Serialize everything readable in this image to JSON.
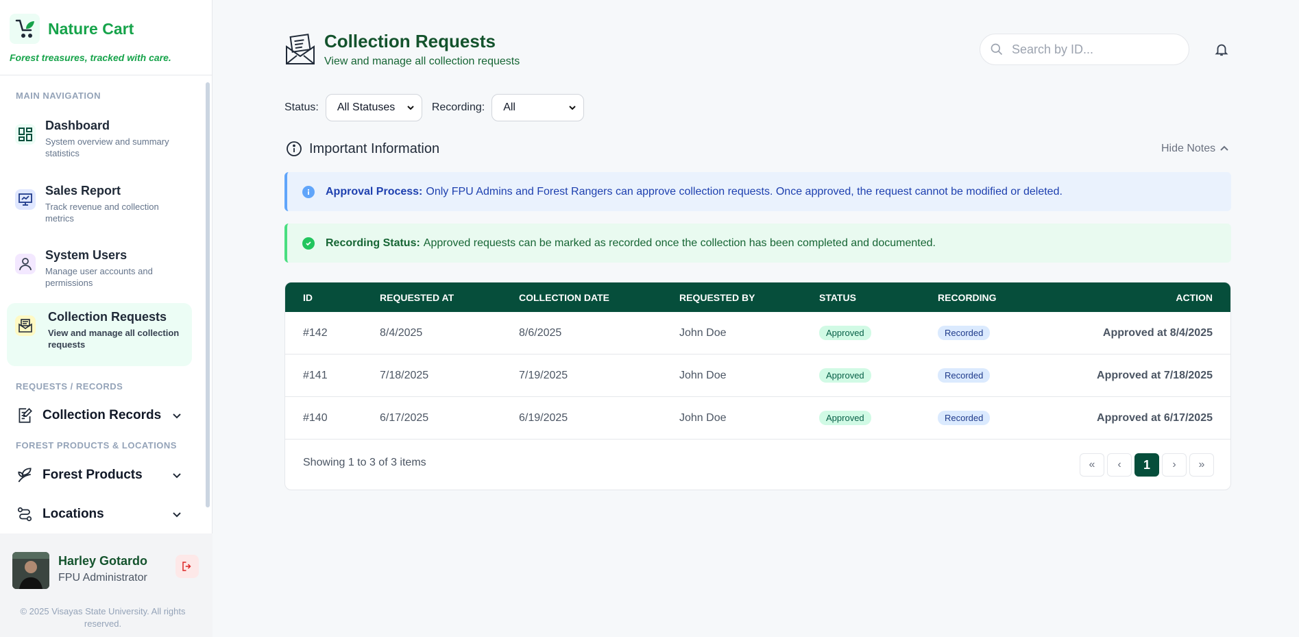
{
  "brand": {
    "name": "Nature Cart",
    "tagline": "Forest treasures, tracked with care."
  },
  "sidebar": {
    "main_nav_label": "MAIN NAVIGATION",
    "items": [
      {
        "title": "Dashboard",
        "desc": "System overview and summary statistics"
      },
      {
        "title": "Sales Report",
        "desc": "Track revenue and collection metrics"
      },
      {
        "title": "System Users",
        "desc": "Manage user accounts and permissions"
      },
      {
        "title": "Collection Requests",
        "desc": "View and manage all collection requests"
      }
    ],
    "requests_label": "REQUESTS / RECORDS",
    "collection_records": "Collection Records",
    "forest_label": "FOREST PRODUCTS & LOCATIONS",
    "forest_products": "Forest Products",
    "locations": "Locations"
  },
  "profile": {
    "name": "Harley Gotardo",
    "role": "FPU Administrator",
    "copyright": "© 2025 Visayas State University. All rights reserved."
  },
  "header": {
    "title": "Collection Requests",
    "subtitle": "View and manage all collection requests",
    "search_placeholder": "Search by ID..."
  },
  "filters": {
    "status_label": "Status:",
    "status_value": "All Statuses",
    "recording_label": "Recording:",
    "recording_value": "All"
  },
  "info": {
    "title": "Important Information",
    "hide_notes": "Hide Notes",
    "approval_label": "Approval Process:",
    "approval_text": "Only FPU Admins and Forest Rangers can approve collection requests. Once approved, the request cannot be modified or deleted.",
    "recording_label": "Recording Status:",
    "recording_text": "Approved requests can be marked as recorded once the collection has been completed and documented."
  },
  "table": {
    "columns": [
      "ID",
      "REQUESTED AT",
      "COLLECTION DATE",
      "REQUESTED BY",
      "STATUS",
      "RECORDING",
      "ACTION"
    ],
    "rows": [
      {
        "id": "#142",
        "requested_at": "8/4/2025",
        "collection_date": "8/6/2025",
        "requested_by": "John Doe",
        "status": "Approved",
        "recording": "Recorded",
        "action": "Approved at 8/4/2025"
      },
      {
        "id": "#141",
        "requested_at": "7/18/2025",
        "collection_date": "7/19/2025",
        "requested_by": "John Doe",
        "status": "Approved",
        "recording": "Recorded",
        "action": "Approved at 7/18/2025"
      },
      {
        "id": "#140",
        "requested_at": "6/17/2025",
        "collection_date": "6/19/2025",
        "requested_by": "John Doe",
        "status": "Approved",
        "recording": "Recorded",
        "action": "Approved at 6/17/2025"
      }
    ],
    "showing": "Showing 1 to 3 of 3 items",
    "current_page": "1"
  },
  "colors": {
    "brand_green": "#16a34a",
    "header_dark": "#064e3b",
    "info_blue": "#60a5fa",
    "info_green": "#4ade80"
  }
}
